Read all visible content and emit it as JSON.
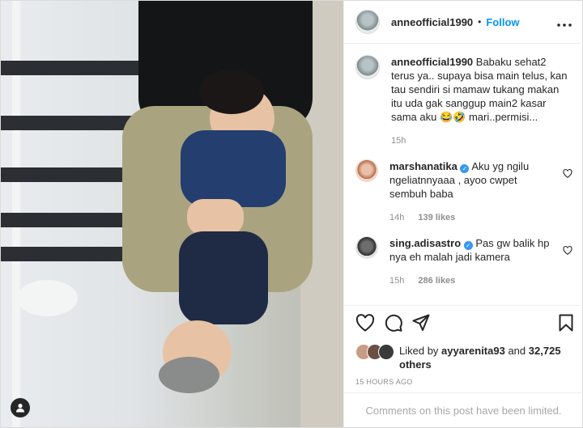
{
  "post": {
    "author": "anneofficial1990",
    "separator": "•",
    "follow_label": "Follow",
    "more_label": "•••"
  },
  "caption": {
    "author": "anneofficial1990",
    "text": "Babaku sehat2 terus ya.. supaya bisa main telus, kan tau sendiri si mamaw tukang makan itu uda gak sanggup main2 kasar sama aku 😂🤣 mari..permisi...",
    "time": "15h"
  },
  "comments": [
    {
      "user": "marshanatika",
      "verified": true,
      "text": "Aku yg ngilu ngeliatnnyaaa , ayoo cwpet sembuh baba",
      "time": "14h",
      "likes": "139 likes"
    },
    {
      "user": "sing.adisastro",
      "verified": true,
      "text": "Pas gw balik hp nya eh malah jadi kamera",
      "time": "15h",
      "likes": "286 likes"
    }
  ],
  "likes_summary": {
    "prefix": "Liked by",
    "user": "ayyarenita93",
    "connector": "and",
    "others": "32,725 others"
  },
  "timestamp": "15 HOURS AGO",
  "comments_limited": "Comments on this post have been limited.",
  "colors": {
    "link_blue": "#0095f6",
    "verified_blue": "#3897f0",
    "text": "#262626",
    "muted": "#8e8e8e"
  },
  "icons": [
    "user-icon",
    "more-icon",
    "heart-icon",
    "comment-icon",
    "share-icon",
    "save-icon",
    "verified-icon"
  ]
}
